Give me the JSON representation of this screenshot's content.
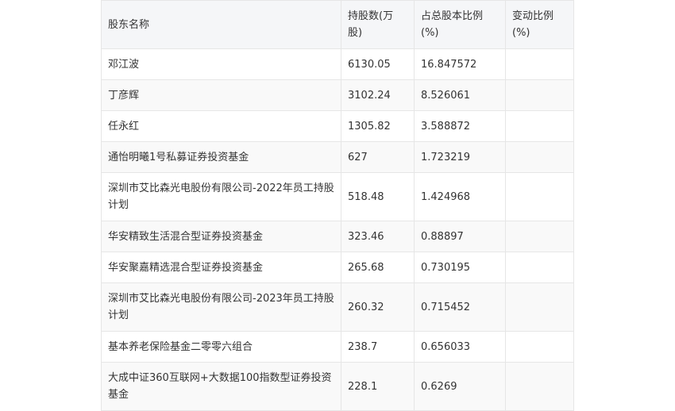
{
  "table": {
    "headers": [
      "股东名称",
      "持股数(万股)",
      "占总股本比例(%)",
      "变动比例(%)"
    ],
    "rows": [
      {
        "name": "邓江波",
        "shares": "6130.05",
        "ratio": "16.847572",
        "change": ""
      },
      {
        "name": "丁彦辉",
        "shares": "3102.24",
        "ratio": "8.526061",
        "change": ""
      },
      {
        "name": "任永红",
        "shares": "1305.82",
        "ratio": "3.588872",
        "change": ""
      },
      {
        "name": "通怡明曦1号私募证券投资基金",
        "shares": "627",
        "ratio": "1.723219",
        "change": ""
      },
      {
        "name": "深圳市艾比森光电股份有限公司-2022年员工持股计划",
        "shares": "518.48",
        "ratio": "1.424968",
        "change": ""
      },
      {
        "name": "华安精致生活混合型证券投资基金",
        "shares": "323.46",
        "ratio": "0.88897",
        "change": ""
      },
      {
        "name": "华安聚嘉精选混合型证券投资基金",
        "shares": "265.68",
        "ratio": "0.730195",
        "change": ""
      },
      {
        "name": "深圳市艾比森光电股份有限公司-2023年员工持股计划",
        "shares": "260.32",
        "ratio": "0.715452",
        "change": ""
      },
      {
        "name": "基本养老保险基金二零零六组合",
        "shares": "238.7",
        "ratio": "0.656033",
        "change": ""
      },
      {
        "name": "大成中证360互联网+大数据100指数型证券投资基金",
        "shares": "228.1",
        "ratio": "0.6269",
        "change": ""
      }
    ]
  }
}
